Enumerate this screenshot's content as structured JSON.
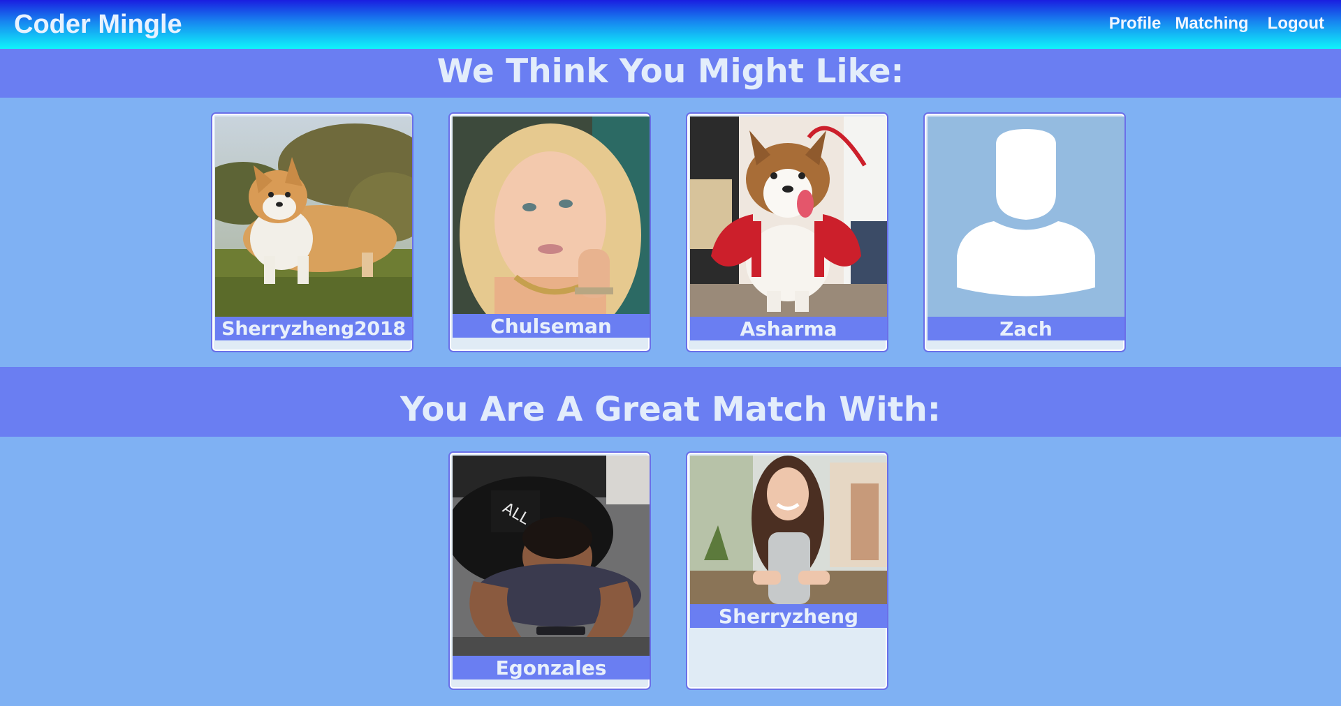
{
  "navbar": {
    "brand": "Coder Mingle",
    "links": [
      "Profile",
      "Matching",
      "Logout"
    ]
  },
  "suggestions": {
    "title": "We Think You Might Like:",
    "profiles": [
      {
        "name": "Sherryzheng2018",
        "photo": "corgi-on-grass-photo"
      },
      {
        "name": "Chulseman",
        "photo": "blonde-woman-selfie-photo"
      },
      {
        "name": "Asharma",
        "photo": "corgi-lobster-costume-photo"
      },
      {
        "name": "Zach",
        "photo": "default-avatar-placeholder"
      }
    ]
  },
  "matches": {
    "title": "You Are A Great Match With:",
    "profiles": [
      {
        "name": "Egonzales",
        "photo": "man-on-phone-photo"
      },
      {
        "name": "Sherryzheng",
        "photo": "smiling-woman-photo"
      }
    ]
  },
  "colors": {
    "page_background": "#7fb1f3",
    "header_band": "#6a7ef2",
    "header_text": "#e3edfb",
    "card_background": "#e0ebf5",
    "card_border": "#6a6fe8",
    "avatar_placeholder_bg": "#94bbe0"
  }
}
